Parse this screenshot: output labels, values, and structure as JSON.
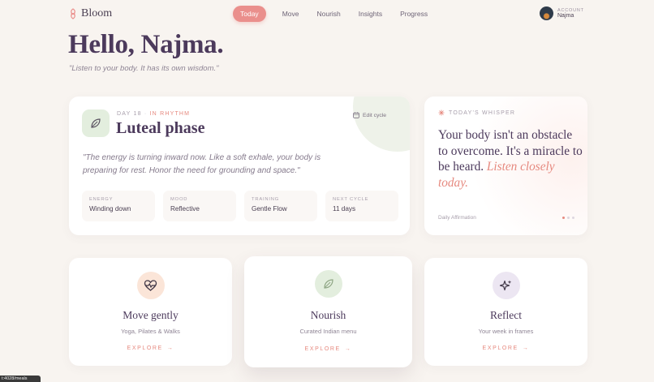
{
  "app": {
    "name": "Bloom",
    "logo_icon": "flower-logo-icon"
  },
  "nav": {
    "items": [
      {
        "label": "Today",
        "active": true
      },
      {
        "label": "Move",
        "active": false
      },
      {
        "label": "Nourish",
        "active": false
      },
      {
        "label": "Insights",
        "active": false
      },
      {
        "label": "Progress",
        "active": false
      }
    ]
  },
  "account": {
    "label": "ACCOUNT",
    "name": "Najma"
  },
  "greeting": {
    "title": "Hello, Najma.",
    "quote": "\"Listen to your body. It has its own wisdom.\""
  },
  "phase": {
    "day": "DAY 18",
    "separator": "·",
    "status": "IN RHYTHM",
    "title": "Luteal phase",
    "edit_label": "Edit cycle",
    "quote": "\"The energy is turning inward now. Like a soft exhale, your body is preparing for rest. Honor the need for grounding and space.\"",
    "stats": [
      {
        "label": "ENERGY",
        "value": "Winding down"
      },
      {
        "label": "MOOD",
        "value": "Reflective"
      },
      {
        "label": "TRAINING",
        "value": "Gentle Flow"
      },
      {
        "label": "NEXT CYCLE",
        "value": "11 days"
      }
    ]
  },
  "whisper": {
    "kicker": "TODAY'S WHISPER",
    "text": "Your body isn't an obstacle to overcome. It's a miracle to be heard.",
    "accent": "Listen closely today.",
    "footer": "Daily Affirmation",
    "dots": 3,
    "active_dot": 0
  },
  "features": [
    {
      "icon": "heart-pulse-icon",
      "title": "Move gently",
      "subtitle": "Yoga, Pilates & Walks",
      "cta": "EXPLORE"
    },
    {
      "icon": "leaf-icon",
      "title": "Nourish",
      "subtitle": "Curated Indian menu",
      "cta": "EXPLORE"
    },
    {
      "icon": "sparkle-icon",
      "title": "Reflect",
      "subtitle": "Your week in frames",
      "cta": "EXPLORE"
    }
  ],
  "status_url": "t:4028/meals",
  "colors": {
    "accent": "#ea8f8c",
    "ink": "#4c3a5c",
    "background": "#f8f4f0"
  }
}
